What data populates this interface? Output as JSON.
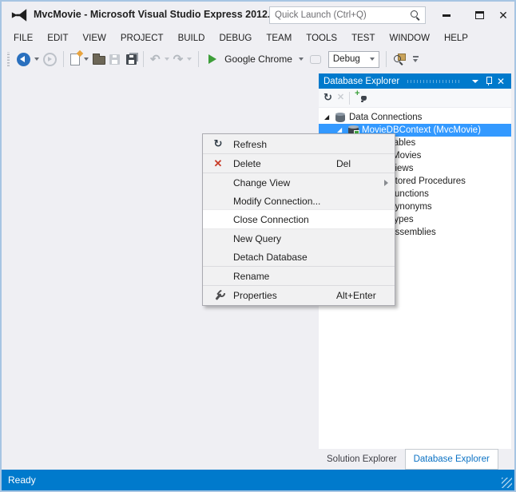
{
  "window": {
    "title": "MvcMovie - Microsoft Visual Studio Express 2012...",
    "logo_icon": "visual-studio-logo",
    "quick_launch": {
      "placeholder": "Quick Launch (Ctrl+Q)",
      "icon": "search-icon"
    }
  },
  "menu_bar": {
    "items": [
      {
        "label": "FILE"
      },
      {
        "label": "EDIT"
      },
      {
        "label": "VIEW"
      },
      {
        "label": "PROJECT"
      },
      {
        "label": "BUILD"
      },
      {
        "label": "DEBUG"
      },
      {
        "label": "TEAM"
      },
      {
        "label": "TOOLS"
      },
      {
        "label": "TEST"
      },
      {
        "label": "WINDOW"
      },
      {
        "label": "HELP"
      }
    ]
  },
  "toolbar": {
    "run_button_label": "Google Chrome",
    "config_select_value": "Debug"
  },
  "database_explorer": {
    "title": "Database Explorer",
    "toolbar_icons": [
      "refresh-icon",
      "delete-icon",
      "connect-database-icon"
    ],
    "tree_items": [
      {
        "label": "Data Connections",
        "level": 0,
        "state": "expanded",
        "icon": "database-stack-icon",
        "selected": false
      },
      {
        "label": "MovieDBContext (MvcMovie)",
        "level": 1,
        "state": "expanded",
        "icon": "database-connection-icon",
        "selected": true
      },
      {
        "label": "Tables",
        "level": 2,
        "state": "expanded",
        "icon": "folder-icon",
        "selected": false
      },
      {
        "label": "Movies",
        "level": 3,
        "state": "collapsed",
        "icon": "table-icon",
        "selected": false
      },
      {
        "label": "Views",
        "level": 2,
        "state": "collapsed",
        "icon": "folder-icon",
        "selected": false
      },
      {
        "label": "Stored Procedures",
        "level": 2,
        "state": "collapsed",
        "icon": "folder-icon",
        "selected": false
      },
      {
        "label": "Functions",
        "level": 2,
        "state": "collapsed",
        "icon": "folder-icon",
        "selected": false
      },
      {
        "label": "Synonyms",
        "level": 2,
        "state": "collapsed",
        "icon": "folder-icon",
        "selected": false
      },
      {
        "label": "Types",
        "level": 2,
        "state": "collapsed",
        "icon": "folder-icon",
        "selected": false
      },
      {
        "label": "Assemblies",
        "level": 2,
        "state": "collapsed",
        "icon": "folder-icon",
        "selected": false
      }
    ]
  },
  "context_menu": {
    "items": [
      {
        "label": "Refresh",
        "icon": "refresh-icon"
      },
      {
        "label": "Delete",
        "icon": "delete-icon",
        "shortcut": "Del"
      },
      {
        "label": "Change View",
        "has_submenu": true
      },
      {
        "label": "Modify Connection..."
      },
      {
        "label": "Close Connection",
        "highlighted": true
      },
      {
        "label": "New Query"
      },
      {
        "label": "Detach Database"
      },
      {
        "label": "Rename"
      },
      {
        "label": "Properties",
        "icon": "wrench-icon",
        "shortcut": "Alt+Enter"
      }
    ]
  },
  "panel_tabs": [
    {
      "label": "Solution Explorer",
      "active": false
    },
    {
      "label": "Database Explorer",
      "active": true
    }
  ],
  "status_bar": {
    "text": "Ready"
  },
  "colors": {
    "accent": "#007ACC",
    "selection": "#3399FF",
    "delete_red": "#C83C28",
    "run_green": "#3D9E39"
  }
}
